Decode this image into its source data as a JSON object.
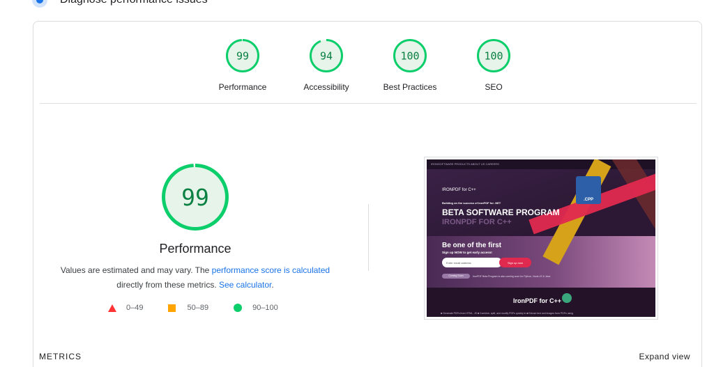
{
  "section": {
    "heading": "Diagnose performance issues"
  },
  "scores": [
    {
      "label": "Performance",
      "value": "99",
      "fraction": 0.99
    },
    {
      "label": "Accessibility",
      "value": "94",
      "fraction": 0.94
    },
    {
      "label": "Best Practices",
      "value": "100",
      "fraction": 1.0
    },
    {
      "label": "SEO",
      "value": "100",
      "fraction": 1.0
    }
  ],
  "performance": {
    "value": "99",
    "fraction": 0.99,
    "title": "Performance",
    "desc_prefix": "Values are estimated and may vary. The ",
    "desc_link1": "performance score is calculated",
    "desc_middle": " directly from these metrics. ",
    "desc_link2": "See calculator",
    "desc_suffix": "."
  },
  "legend": {
    "fail": "0–49",
    "average": "50–89",
    "pass": "90–100"
  },
  "screenshot": {
    "nav_text": "IRONSOFTWARE     PRODUCTS     ABOUT US     CAREERS",
    "logo": "IRONPDF for C++",
    "subtitle": "Building on the success of IronPDF for .NET",
    "headline": "BETA SOFTWARE PROGRAM",
    "product": "IRONPDF FOR C++",
    "badge": ".CPP",
    "cta_title": "Be one of the first",
    "cta_sub": "Sign up NOW to get early access!",
    "email_placeholder": "Enter email address",
    "signup_button": "Sign up now",
    "pill": "Coming Soon",
    "pill_text": "IronPDF Beta Program is also coming soon for Python, Node.JS & Java",
    "footer_title": "IronPDF for C++",
    "footer_list": "■ Generate PDFs from HTML, JS     ■ Combine, split, and modify PDFs quickly in     ■ Extract text and images from PDFs using"
  },
  "metrics": {
    "label": "METRICS",
    "expand": "Expand view"
  },
  "colors": {
    "pass_ring": "#0cce6b",
    "pass_fill": "#e6f4ea",
    "pass_text": "#0b8043",
    "fail": "#ff3333",
    "average": "#ffa400",
    "link": "#1a73e8"
  }
}
